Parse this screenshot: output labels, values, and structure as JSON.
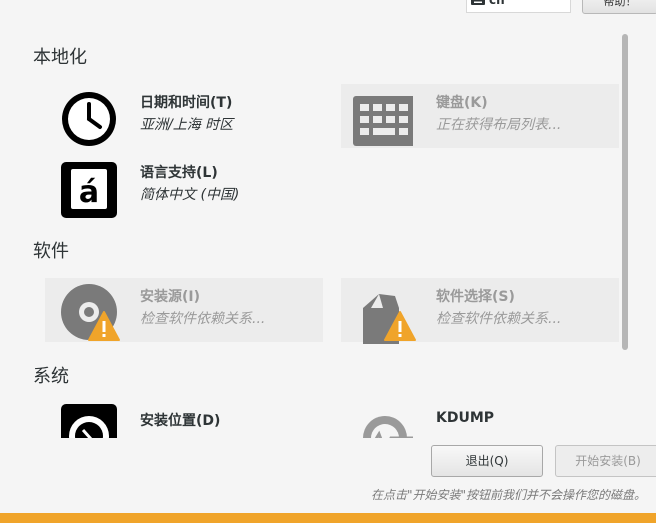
{
  "topbar": {
    "keyboard_layout": "cn",
    "help_label": "帮助！"
  },
  "sections": {
    "localization": "本地化",
    "software": "软件",
    "system": "系统"
  },
  "spokes": {
    "datetime": {
      "title": "日期和时间(T)",
      "status": "亚洲/上海 时区"
    },
    "keyboard": {
      "title": "键盘(K)",
      "status": "正在获得布局列表..."
    },
    "language": {
      "title": "语言支持(L)",
      "status": "简体中文 (中国)"
    },
    "install_source": {
      "title": "安装源(I)",
      "status": "检查软件依赖关系..."
    },
    "software_selection": {
      "title": "软件选择(S)",
      "status": "检查软件依赖关系..."
    },
    "install_destination": {
      "title": "安装位置(D)",
      "status": ""
    },
    "kdump": {
      "title": "KDUMP",
      "status": ""
    }
  },
  "buttons": {
    "quit": "退出(Q)",
    "begin_install": "开始安装(B)"
  },
  "hint": "在点击\"开始安装\"按钮前我们并不会操作您的磁盘。",
  "colors": {
    "warning": "#f0a42a",
    "background": "#f5f5f5",
    "disabled_text": "#9a9a9a"
  }
}
